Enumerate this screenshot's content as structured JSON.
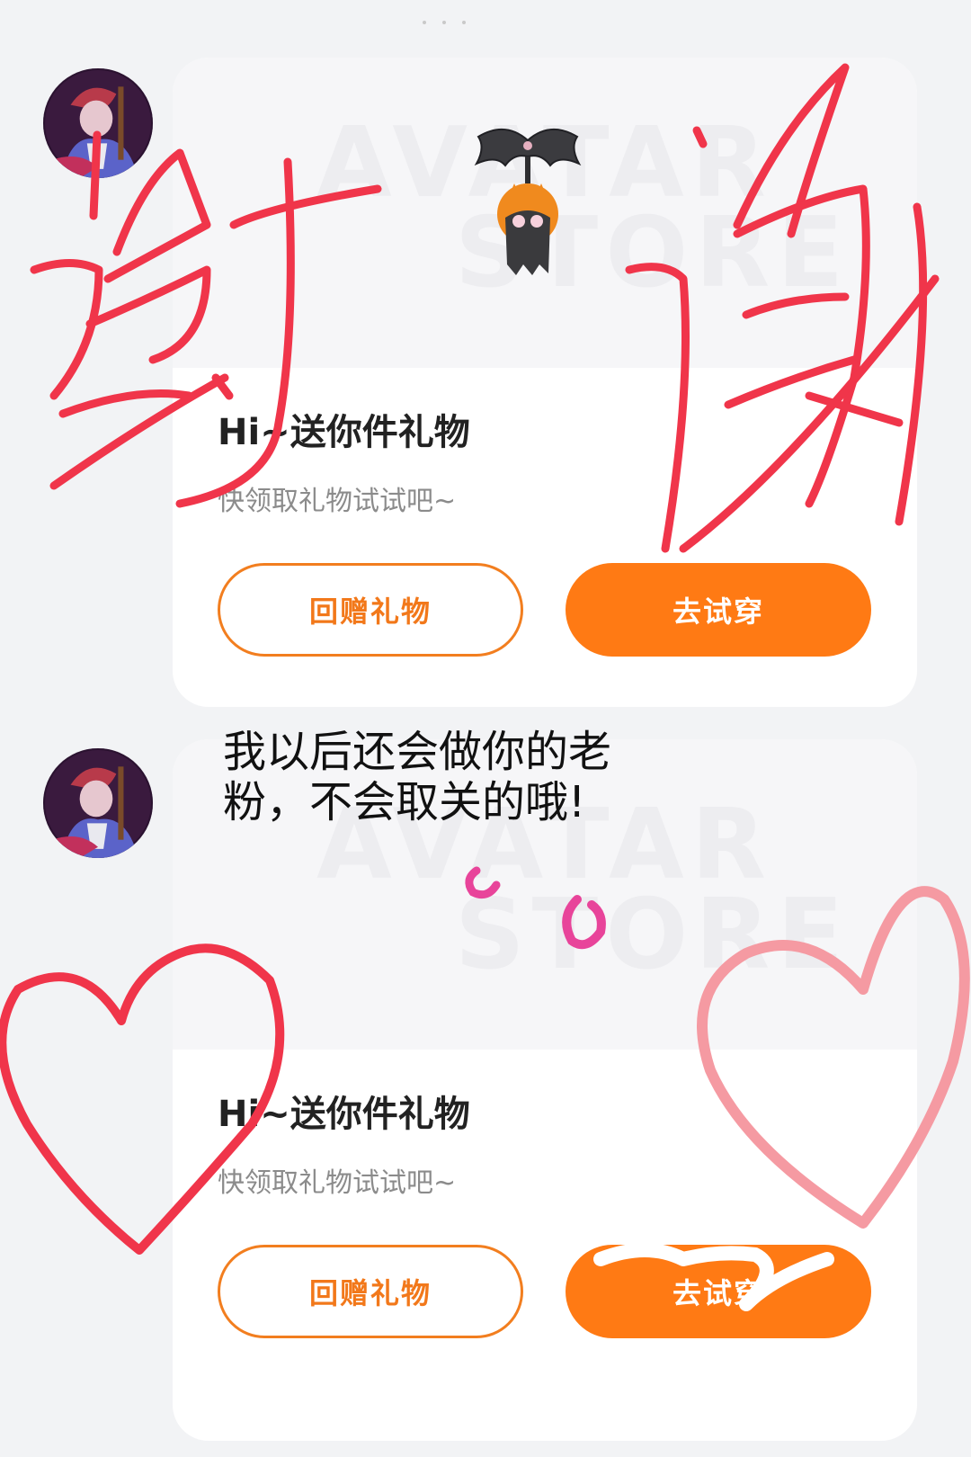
{
  "messages": [
    {
      "card": {
        "watermark_line1": "AVATAR",
        "watermark_line2": "STORE",
        "gift_item": "bat-pendant-earring",
        "title": "Hi~送你件礼物",
        "subtitle": "快领取礼物试试吧~",
        "return_gift_label": "回赠礼物",
        "try_on_label": "去试穿"
      }
    },
    {
      "card": {
        "watermark_line1": "AVATAR",
        "watermark_line2": "STORE",
        "gift_item": "pink-hoop-earrings",
        "title": "Hi~送你件礼物",
        "subtitle": "快领取礼物试试吧~",
        "return_gift_label": "回赠礼物",
        "try_on_label": "去试穿"
      }
    }
  ],
  "overlay_caption": {
    "line1": "我以后还会做你的老",
    "line2": "粉，不会取关的哦!"
  },
  "handwriting": {
    "left_char": "谢",
    "right_char": "谢"
  },
  "colors": {
    "accent": "#ff7a14",
    "ink_red": "#f0354a",
    "ink_pink": "#f59aa2"
  }
}
